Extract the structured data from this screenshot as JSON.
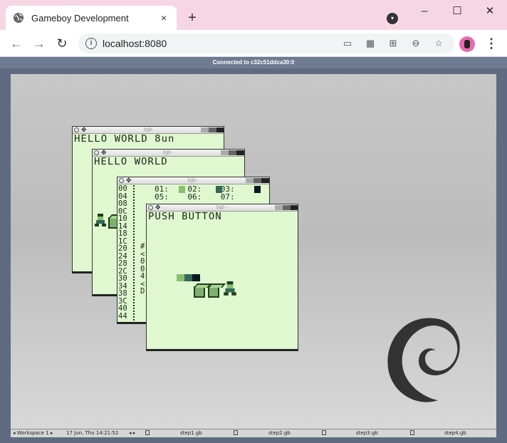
{
  "browser": {
    "tab_title": "Gameboy Development",
    "tab_close": "×",
    "new_tab": "+",
    "url": "localhost:8080",
    "window_controls": {
      "minimize": "–",
      "maximize": "☐",
      "close": "✕"
    }
  },
  "vnc": {
    "status": "Connected to c32c51ddca30:0"
  },
  "taskbar": {
    "workspace": "◂ Workspace 1 ▸",
    "clock": "17 Jun, Thu 14:21:52",
    "arrows": "◂ ▸",
    "tasks": [
      {
        "label": "step1.gb"
      },
      {
        "label": "step2.gb"
      },
      {
        "label": "step3.gb"
      },
      {
        "label": "step4.gb"
      }
    ]
  },
  "gb_windows": [
    {
      "title": "bgb",
      "text": "HELLO WORLD 8un"
    },
    {
      "title": "bgb -",
      "text": "HELLO WORLD"
    },
    {
      "title": "bgb -",
      "hex_rows": [
        "00",
        "04",
        "08",
        "0C",
        "10",
        "14",
        "18",
        "1C",
        "20",
        "24",
        "28",
        "2C",
        "30",
        "34",
        "38",
        "3C",
        "40",
        "44"
      ],
      "hex_top": "01:    02:    03:",
      "hex_second": "05:    06:    07:",
      "hex_partial": [
        "#",
        "<",
        "0",
        "0",
        "4",
        "<",
        "D"
      ]
    },
    {
      "title": "bgb -",
      "text": "PUSH BUTTON"
    }
  ],
  "colors": {
    "gb_bg": "#e0f8d0",
    "gb_light": "#88c070",
    "gb_mid": "#346856",
    "gb_dark": "#081820",
    "vnc_bar": "#6e7b92",
    "tab_strip": "#f7d6e4"
  }
}
